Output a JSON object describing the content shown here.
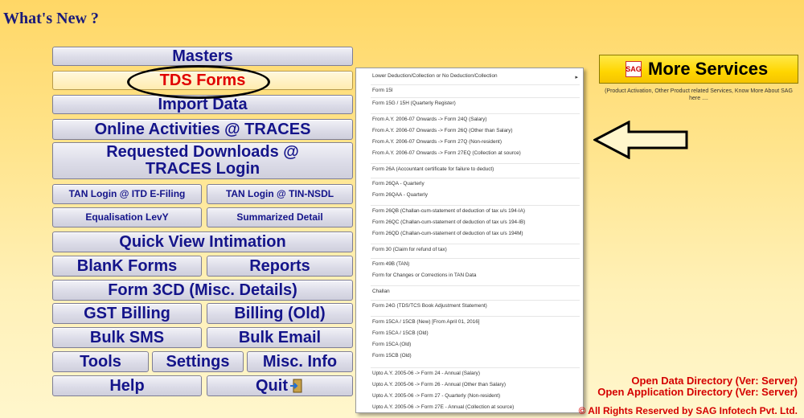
{
  "header": {
    "title": "What's New ?"
  },
  "buttons": {
    "masters": "Masters",
    "tds_forms": "TDS Forms",
    "import_data": "Import Data",
    "online_activities": "Online Activities @ TRACES",
    "requested_downloads": "Requested Downloads @ TRACES Login",
    "tan_login_itd": "TAN Login @ ITD E-Filing",
    "tan_login_nsdl": "TAN Login @ TIN-NSDL",
    "equalisation_levy": "Equalisation LevY",
    "summarized_detail": "Summarized Detail",
    "quick_view": "Quick View Intimation",
    "blank_forms": "BlanK Forms",
    "reports": "Reports",
    "form_3cd": "Form 3CD (Misc. Details)",
    "gst_billing": "GST Billing",
    "billing_old": "Billing (Old)",
    "bulk_sms": "Bulk SMS",
    "bulk_email": "Bulk Email",
    "tools": "Tools",
    "settings": "Settings",
    "misc_info": "Misc. Info",
    "help": "Help",
    "quit": "Quit"
  },
  "menu": {
    "items": [
      "Lower Deduction/Collection or No Deduction/Collection",
      "Form 15I",
      "Form 15G / 15H (Quarterly Register)",
      "From A.Y. 2006-07 Onwards -> Form 24Q (Salary)",
      "From A.Y. 2006-07 Onwards -> Form 26Q (Other than Salary)",
      "From A.Y. 2006-07 Onwards -> Form 27Q (Non-resident)",
      "From A.Y. 2006-07 Onwards -> Form 27EQ (Collection at source)",
      "Form 26A (Accountant certificate for failure to deduct)",
      "Form 26QA - Quarterly",
      "Form 26QAA - Quarterly",
      "Form 26QB (Challan-cum-statement of deduction of tax u/s 194-IA)",
      "Form 26QC (Challan-cum-statement of deduction of tax u/s 194-IB)",
      "Form 26QD (Challan-cum-statement of deduction of tax u/s 194M)",
      "Form 30 (Claim for refund of tax)",
      "Form 49B (TAN)",
      "Form for Changes or Corrections in TAN Data",
      "Challan",
      "Form 24G (TDS/TCS Book Adjustment Statement)",
      "Form 15CA / 15CB (New) [From April 01, 2016]",
      "Form 15CA / 15CB (Old)",
      "Form 15CA (Old)",
      "Form 15CB (Old)",
      "Upto A.Y. 2005-06 -> Form 24 - Annual (Salary)",
      "Upto A.Y. 2005-06 -> Form 26 - Annual (Other than Salary)",
      "Upto A.Y. 2005-06 -> Form 27 - Quarterly (Non-resident)",
      "Upto A.Y. 2005-06 -> Form 27E - Annual (Collection at source)"
    ],
    "submenu_arrow": "▸"
  },
  "more_services": {
    "label": "More Services",
    "icon_text": "SAG",
    "description": "(Product Activation, Other Product related Services, Know More About SAG here ...."
  },
  "footer": {
    "open_data": "Open Data Directory (Ver: Server)",
    "open_app": "Open Application Directory (Ver: Server)",
    "copyright": "© All Rights Reserved by SAG Infotech Pvt. Ltd."
  },
  "colors": {
    "button_text": "#14148a",
    "selected_text": "#e00000",
    "footer_text": "#d40000",
    "highlight": "#ffd500"
  }
}
